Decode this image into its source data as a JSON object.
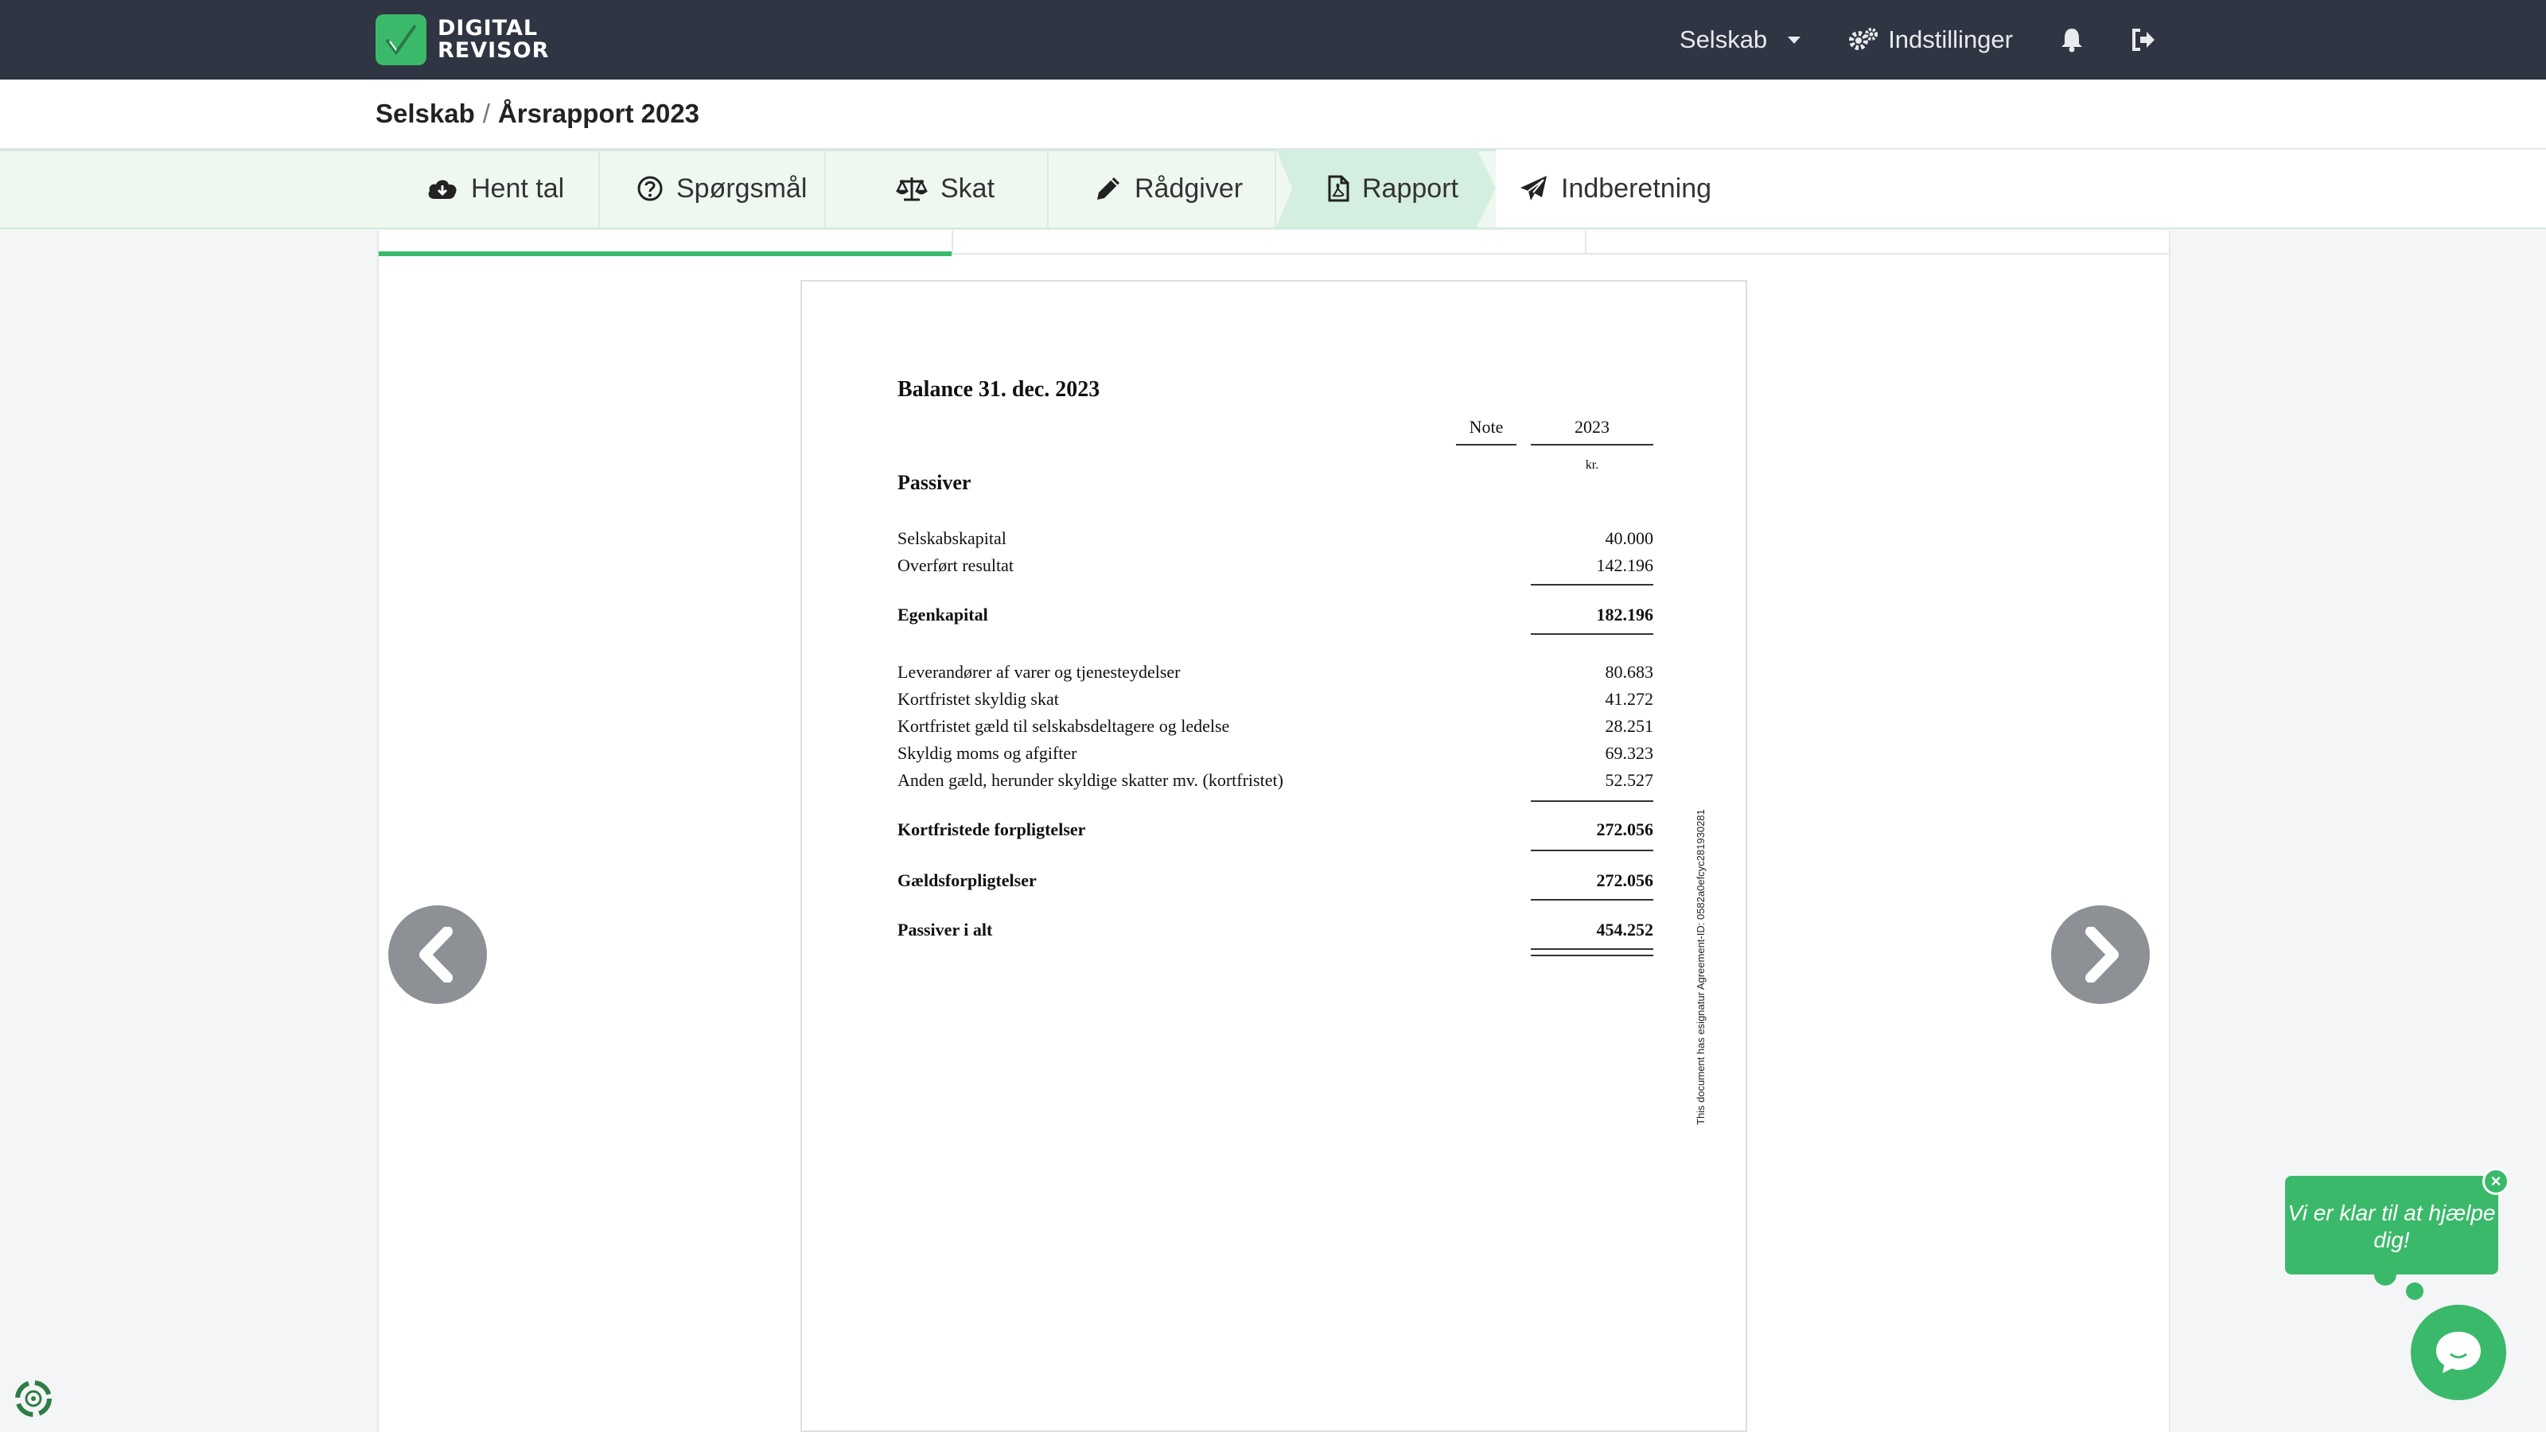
{
  "app": {
    "logo_line1": "DIGITAL",
    "logo_line2": "REVISOR",
    "brand_color": "#3bb96a",
    "topbar_color": "#2f3542"
  },
  "nav": {
    "company_label": "Selskab",
    "settings_label": "Indstillinger",
    "bell_icon": "bell-icon",
    "logout_icon": "logout-icon"
  },
  "breadcrumb": {
    "root": "Selskab",
    "separator": "/",
    "current": "Årsrapport 2023"
  },
  "steps": [
    {
      "label": "Hent tal",
      "icon": "cloud-download-icon"
    },
    {
      "label": "Spørgsmål",
      "icon": "question-circle-icon"
    },
    {
      "label": "Skat",
      "icon": "scale-icon"
    },
    {
      "label": "Rådgiver",
      "icon": "pencil-icon"
    },
    {
      "label": "Rapport",
      "icon": "file-pdf-icon",
      "active": true
    },
    {
      "label": "Indberetning",
      "icon": "paper-plane-icon"
    }
  ],
  "document": {
    "title": "Balance 31. dec. 2023",
    "col_note": "Note",
    "col_year": "2023",
    "unit": "kr.",
    "section": "Passiver",
    "rows": [
      {
        "label": "Selskabskapital",
        "value": "40.000"
      },
      {
        "label": "Overført resultat",
        "value": "142.196"
      },
      {
        "label": "Egenkapital",
        "value": "182.196",
        "bold": true
      },
      {
        "label": "Leverandører af varer og tjenesteydelser",
        "value": "80.683"
      },
      {
        "label": "Kortfristet skyldig skat",
        "value": "41.272"
      },
      {
        "label": "Kortfristet gæld til selskabsdeltagere og ledelse",
        "value": "28.251"
      },
      {
        "label": "Skyldig moms og afgifter",
        "value": "69.323"
      },
      {
        "label": "Anden gæld, herunder skyldige skatter mv. (kortfristet)",
        "value": "52.527"
      },
      {
        "label": "Kortfristede forpligtelser",
        "value": "272.056",
        "bold": true
      },
      {
        "label": "Gældsforpligtelser",
        "value": "272.056",
        "bold": true
      },
      {
        "label": "Passiver i alt",
        "value": "454.252",
        "bold": true
      }
    ],
    "side_note": "This document has esignatur Agreement-ID: 0582a0efcyc281930281"
  },
  "chat": {
    "message": "Vi er klar til at hjælpe dig!",
    "close_label": "×"
  }
}
